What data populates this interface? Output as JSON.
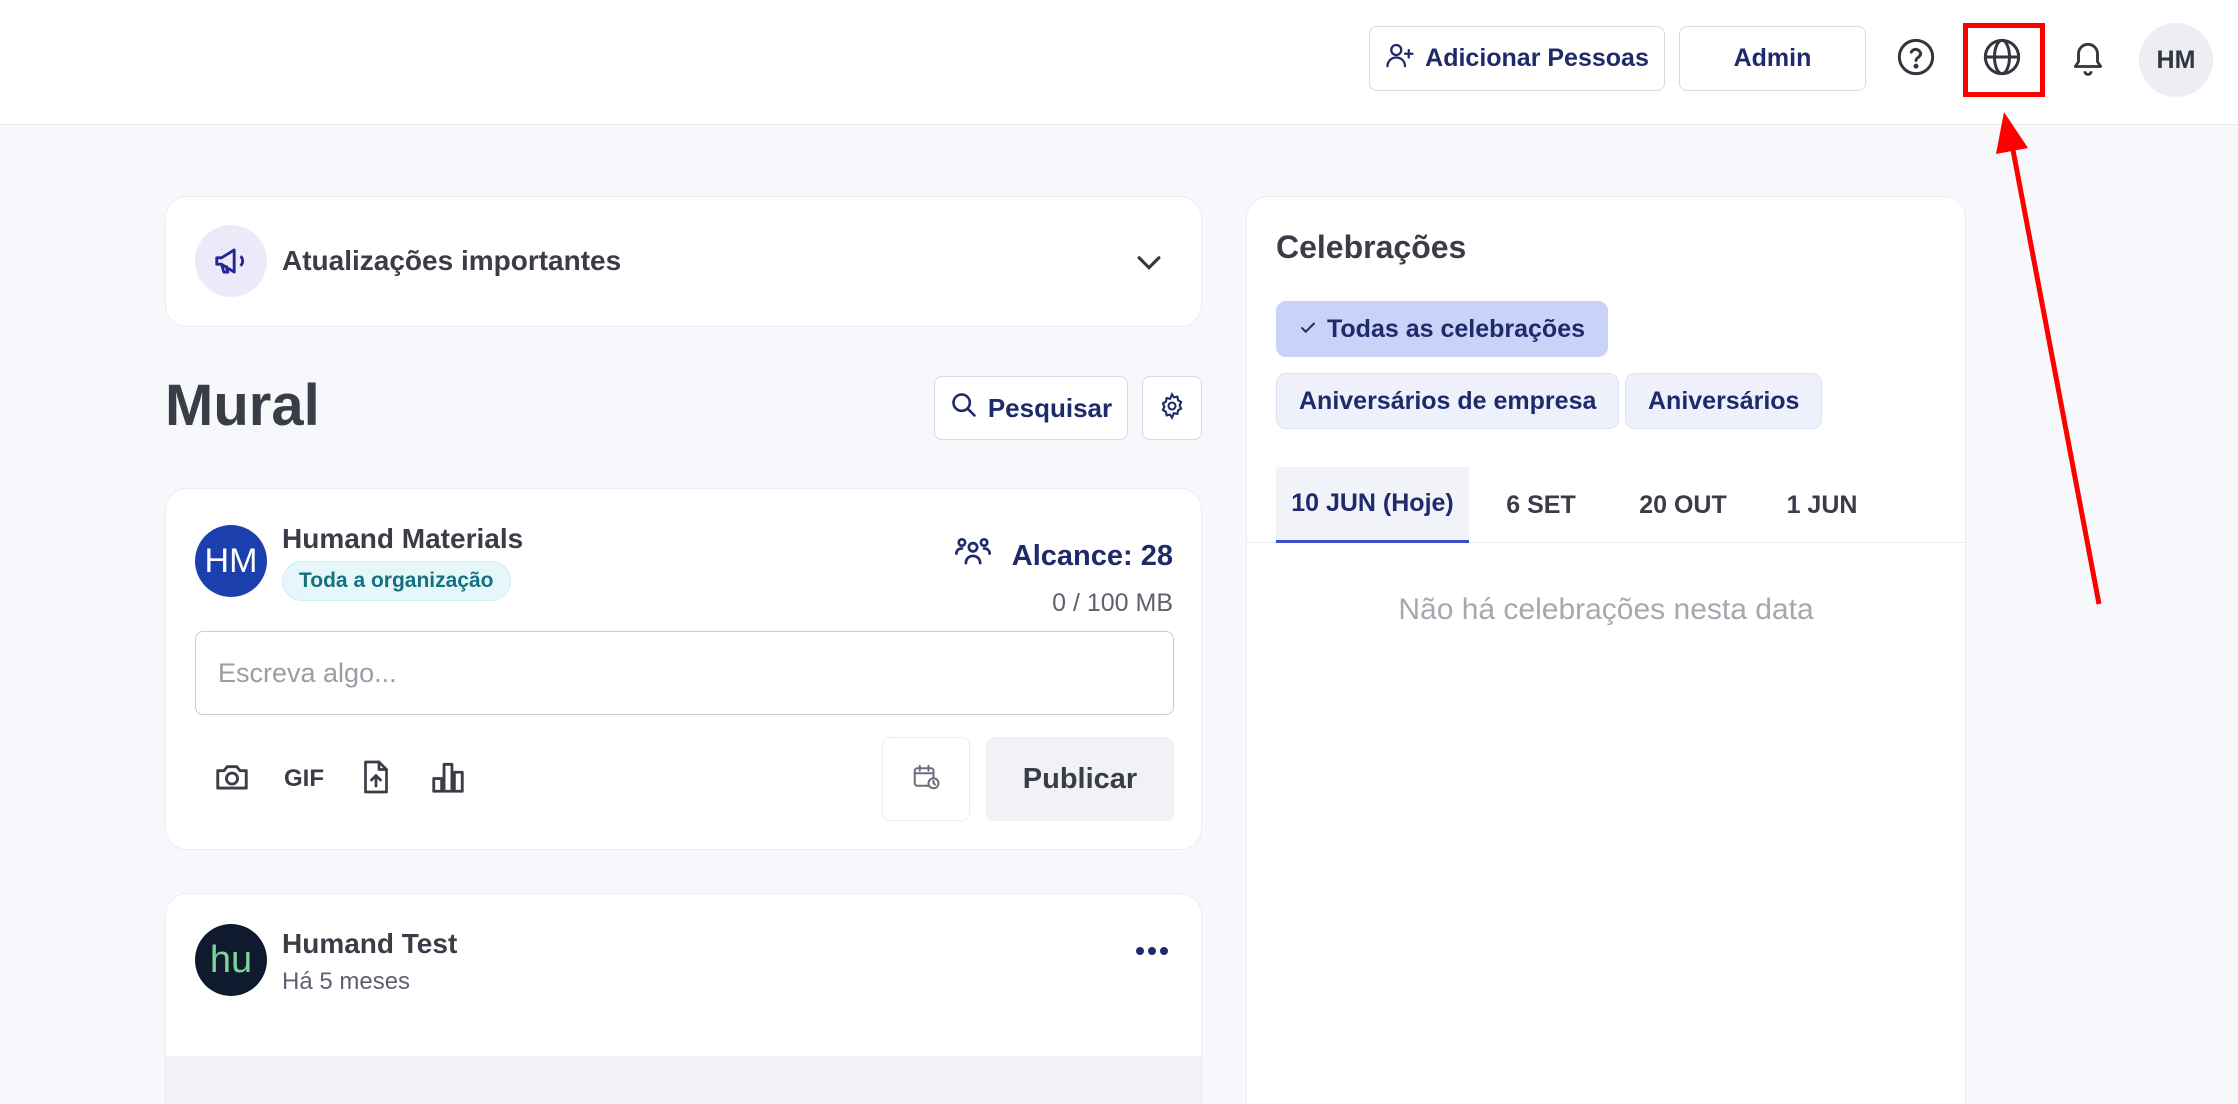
{
  "header": {
    "add_people_label": "Adicionar Pessoas",
    "admin_label": "Admin",
    "avatar_initials": "HM"
  },
  "updates": {
    "title": "Atualizações importantes"
  },
  "mural": {
    "title": "Mural",
    "search_label": "Pesquisar"
  },
  "composer": {
    "author": "Humand Materials",
    "avatar_initials": "HM",
    "audience": "Toda a organização",
    "reach": "Alcance: 28",
    "storage": "0 / 100 MB",
    "placeholder": "Escreva algo...",
    "gif_label": "GIF",
    "publish_label": "Publicar"
  },
  "post": {
    "author": "Humand Test",
    "avatar_text": "hu",
    "time": "Há 5 meses"
  },
  "celebrations": {
    "title": "Celebrações",
    "chips": [
      "Todas as celebrações",
      "Aniversários de empresa",
      "Aniversários"
    ],
    "tabs": [
      "10 JUN (Hoje)",
      "6 SET",
      "20 OUT",
      "1 JUN"
    ],
    "empty_text": "Não há celebrações nesta data"
  },
  "icons": {
    "add_people": "person-plus-icon",
    "help": "question-circle-icon",
    "language": "globe-icon",
    "notifications": "bell-icon",
    "updates": "megaphone-icon",
    "expand": "chevron-down-icon",
    "search": "search-icon",
    "settings": "gear-icon",
    "reach": "people-icon",
    "camera": "camera-icon",
    "file": "file-upload-icon",
    "poll": "bar-chart-icon",
    "schedule": "calendar-clock-icon",
    "more": "more-horizontal-icon",
    "check": "check-icon"
  },
  "colors": {
    "brand": "#1f2a6b",
    "accent": "#3a4fc4",
    "annotation": "#ff0000"
  }
}
